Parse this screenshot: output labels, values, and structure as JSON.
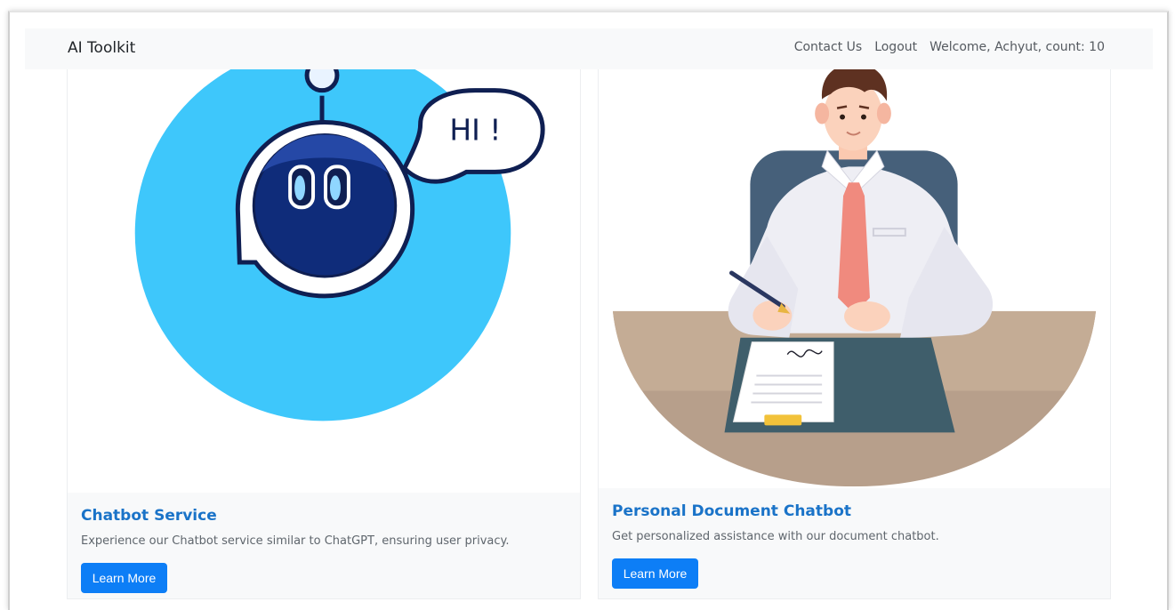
{
  "navbar": {
    "brand": "AI Toolkit",
    "links": [
      "Contact Us",
      "Logout",
      "Welcome, Achyut, count: 10"
    ]
  },
  "cards": [
    {
      "title": "Chatbot Service",
      "text": "Experience our Chatbot service similar to ChatGPT, ensuring user privacy.",
      "button": "Learn More",
      "image_speech": "HI !"
    },
    {
      "title": "Personal Document Chatbot",
      "text": "Get personalized assistance with our document chatbot.",
      "button": "Learn More"
    }
  ],
  "colors": {
    "accent": "#0d7ef6",
    "title": "#1a73c8",
    "robot_circle": "#3ec7fb",
    "robot_head": "#0f2c7a"
  }
}
